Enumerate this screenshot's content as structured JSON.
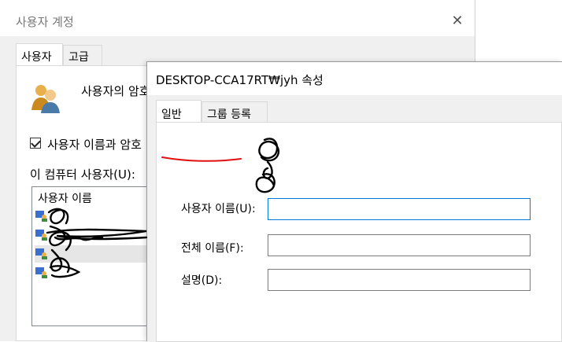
{
  "back_window": {
    "title": "사용자 계정",
    "tabs": [
      {
        "label": "사용자"
      },
      {
        "label": "고급"
      }
    ],
    "description_text": "사용자의 암호",
    "checkbox_label": "사용자 이름과 암호",
    "checkbox_checked": true,
    "users_label": "이 컴퓨터 사용자(U):",
    "list_header": "사용자 이름"
  },
  "front_window": {
    "title": "DESKTOP-CCA17RT₩jyh 속성",
    "tabs": [
      {
        "label": "일반"
      },
      {
        "label": "그룹 등록"
      }
    ],
    "fields": [
      {
        "label": "사용자 이름(U):",
        "value": ""
      },
      {
        "label": "전체 이름(F):",
        "value": ""
      },
      {
        "label": "설명(D):",
        "value": ""
      }
    ]
  },
  "colors": {
    "annotation": "#e01010",
    "scribble": "#000000",
    "focus_border": "#0078d7"
  }
}
